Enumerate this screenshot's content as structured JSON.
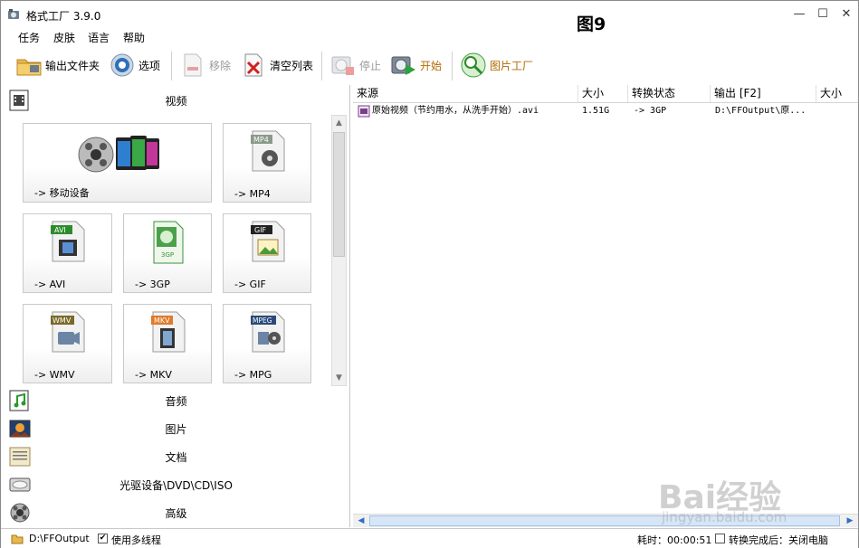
{
  "window": {
    "title": "格式工厂 3.9.0",
    "figure_label": "图9",
    "minimize": "—",
    "maximize": "☐",
    "close": "✕"
  },
  "menu": [
    "任务",
    "皮肤",
    "语言",
    "帮助"
  ],
  "toolbar": {
    "output_folder": "输出文件夹",
    "options": "选项",
    "remove": "移除",
    "clear_list": "清空列表",
    "stop": "停止",
    "start": "开始",
    "picture_factory": "图片工厂"
  },
  "categories": {
    "video": "视频",
    "audio": "音频",
    "image": "图片",
    "document": "文档",
    "disc": "光驱设备\\DVD\\CD\\ISO",
    "advanced": "高级"
  },
  "video_tiles": [
    {
      "label": "-> 移动设备",
      "icon": "mobile-device-icon"
    },
    {
      "label": "-> MP4",
      "badge": "MP4",
      "icon": "mp4-file-icon"
    },
    {
      "label": "-> AVI",
      "badge": "AVI",
      "icon": "avi-file-icon"
    },
    {
      "label": "-> 3GP",
      "badge": "3GP",
      "icon": "3gp-file-icon"
    },
    {
      "label": "-> GIF",
      "badge": "GIF",
      "icon": "gif-file-icon"
    },
    {
      "label": "-> WMV",
      "badge": "WMV",
      "icon": "wmv-file-icon"
    },
    {
      "label": "-> MKV",
      "badge": "MKV",
      "icon": "mkv-file-icon"
    },
    {
      "label": "-> MPG",
      "badge": "MPEG",
      "icon": "mpeg-file-icon"
    }
  ],
  "table": {
    "columns": [
      "来源",
      "大小",
      "转换状态",
      "输出 [F2]",
      "大小"
    ],
    "rows": [
      {
        "source": "原始视频（节约用水，从洗手开始）.avi",
        "size": "1.51G",
        "status": "-> 3GP",
        "output": "D:\\FFOutput\\原...",
        "out_size": ""
      }
    ]
  },
  "status": {
    "output_path": "D:\\FFOutput",
    "multithread_label": "使用多线程",
    "multithread_checked": true,
    "elapsed": "耗时：00:00:51",
    "after_done_label": "转换完成后：关闭电脑",
    "after_done_checked": false
  },
  "colors": {
    "accent_blue": "#2a6fc9",
    "selected": "#d6e6f7"
  }
}
